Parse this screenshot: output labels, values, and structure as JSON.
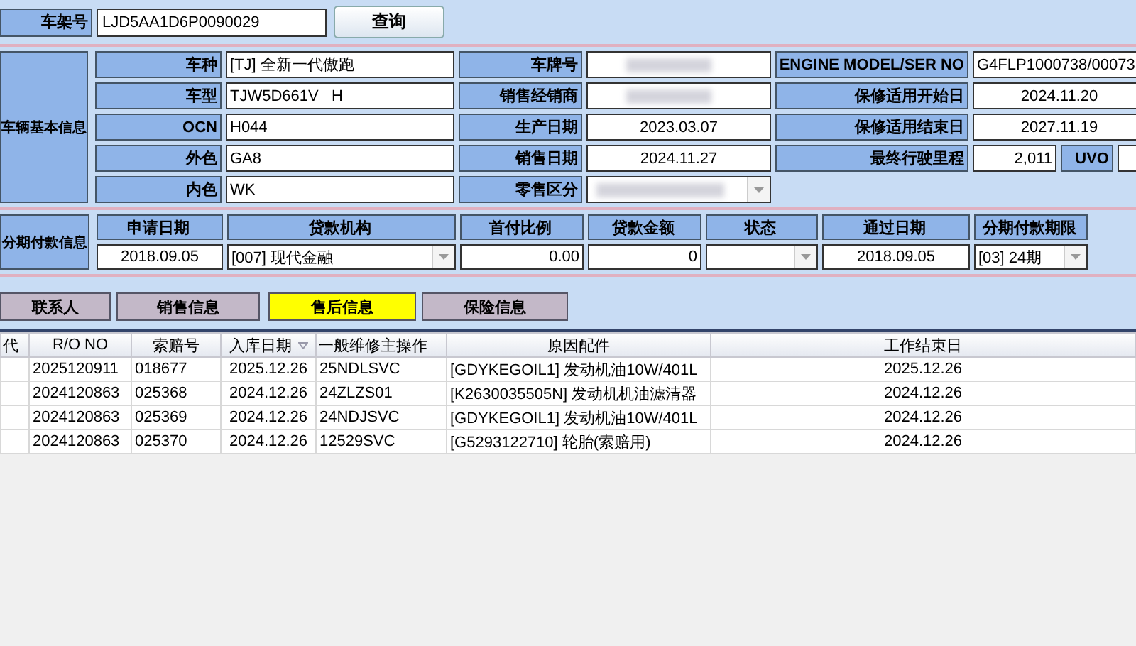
{
  "search": {
    "label": "车架号",
    "value": "LJD5AA1D6P0090029",
    "button": "查询"
  },
  "vehicle": {
    "title": "车辆基本信息",
    "rows": [
      [
        {
          "kind": "label",
          "text": "车种"
        },
        {
          "kind": "text",
          "text": "[TJ] 全新一代傲跑"
        },
        {
          "kind": "label",
          "text": "车牌号"
        },
        {
          "kind": "redacted"
        },
        {
          "kind": "label",
          "text": "ENGINE MODEL/SER NO"
        },
        {
          "kind": "text",
          "text": "G4FLP1000738/00073"
        }
      ],
      [
        {
          "kind": "label",
          "text": "车型"
        },
        {
          "kind": "text",
          "text": "TJW5D661V   H"
        },
        {
          "kind": "label",
          "text": "销售经销商"
        },
        {
          "kind": "redacted"
        },
        {
          "kind": "label",
          "text": "保修适用开始日"
        },
        {
          "kind": "date",
          "text": "2024.11.20"
        }
      ],
      [
        {
          "kind": "label",
          "text": "OCN"
        },
        {
          "kind": "text",
          "text": "H044"
        },
        {
          "kind": "label",
          "text": "生产日期"
        },
        {
          "kind": "date",
          "text": "2023.03.07"
        },
        {
          "kind": "label",
          "text": "保修适用结束日"
        },
        {
          "kind": "date",
          "text": "2027.11.19"
        }
      ],
      [
        {
          "kind": "label",
          "text": "外色"
        },
        {
          "kind": "text",
          "text": "GA8"
        },
        {
          "kind": "label",
          "text": "销售日期"
        },
        {
          "kind": "date",
          "text": "2024.11.27"
        },
        {
          "kind": "label",
          "text": "最终行驶里程"
        },
        {
          "kind": "number",
          "text": "2,011"
        },
        {
          "kind": "label",
          "text": "UVO"
        },
        {
          "kind": "text"
        }
      ],
      [
        {
          "kind": "label",
          "text": "内色"
        },
        {
          "kind": "text",
          "text": "WK"
        },
        {
          "kind": "label",
          "text": "零售区分"
        },
        {
          "kind": "redacted-dropdown"
        }
      ]
    ]
  },
  "finance": {
    "title": "分期付款信息",
    "columns": [
      {
        "header": "申请日期",
        "kind": "date",
        "value": "2018.09.05"
      },
      {
        "header": "贷款机构",
        "kind": "dropdown",
        "value": "[007] 现代金融"
      },
      {
        "header": "首付比例",
        "kind": "number",
        "value": "0.00"
      },
      {
        "header": "贷款金额",
        "kind": "number",
        "value": "0"
      },
      {
        "header": "状态",
        "kind": "dropdown"
      },
      {
        "header": "通过日期",
        "kind": "date",
        "value": "2018.09.05"
      },
      {
        "header": "分期付款期限",
        "kind": "dropdown",
        "value": "[03] 24期"
      }
    ]
  },
  "tabs": [
    {
      "label": "联系人",
      "selected": false
    },
    {
      "label": "销售信息",
      "selected": false
    },
    {
      "label": "售后信息",
      "selected": true
    },
    {
      "label": "保险信息",
      "selected": false
    }
  ],
  "table": {
    "columns": [
      {
        "label": "代",
        "sorted": false
      },
      {
        "label": "R/O NO",
        "sorted": false
      },
      {
        "label": "索赔号",
        "sorted": false
      },
      {
        "label": "入库日期",
        "sorted": true
      },
      {
        "label": "一般维修主操作",
        "sorted": false
      },
      {
        "label": "原因配件",
        "sorted": false
      },
      {
        "label": "工作结束日",
        "sorted": false
      }
    ],
    "rows": [
      [
        "",
        "2025120911",
        "018677",
        "2025.12.26",
        "25NDLSVC",
        "[GDYKEGOIL1] 发动机油10W/401L",
        "2025.12.26"
      ],
      [
        "",
        "2024120863",
        "025368",
        "2024.12.26",
        "24ZLZS01",
        "[K2630035505N] 发动机机油滤清器",
        "2024.12.26"
      ],
      [
        "",
        "2024120863",
        "025369",
        "2024.12.26",
        "24NDJSVC",
        "[GDYKEGOIL1] 发动机油10W/401L",
        "2024.12.26"
      ],
      [
        "",
        "2024120863",
        "025370",
        "2024.12.26",
        "12529SVC",
        "[G5293122710] 轮胎(索赔用)",
        "2024.12.26"
      ]
    ]
  }
}
